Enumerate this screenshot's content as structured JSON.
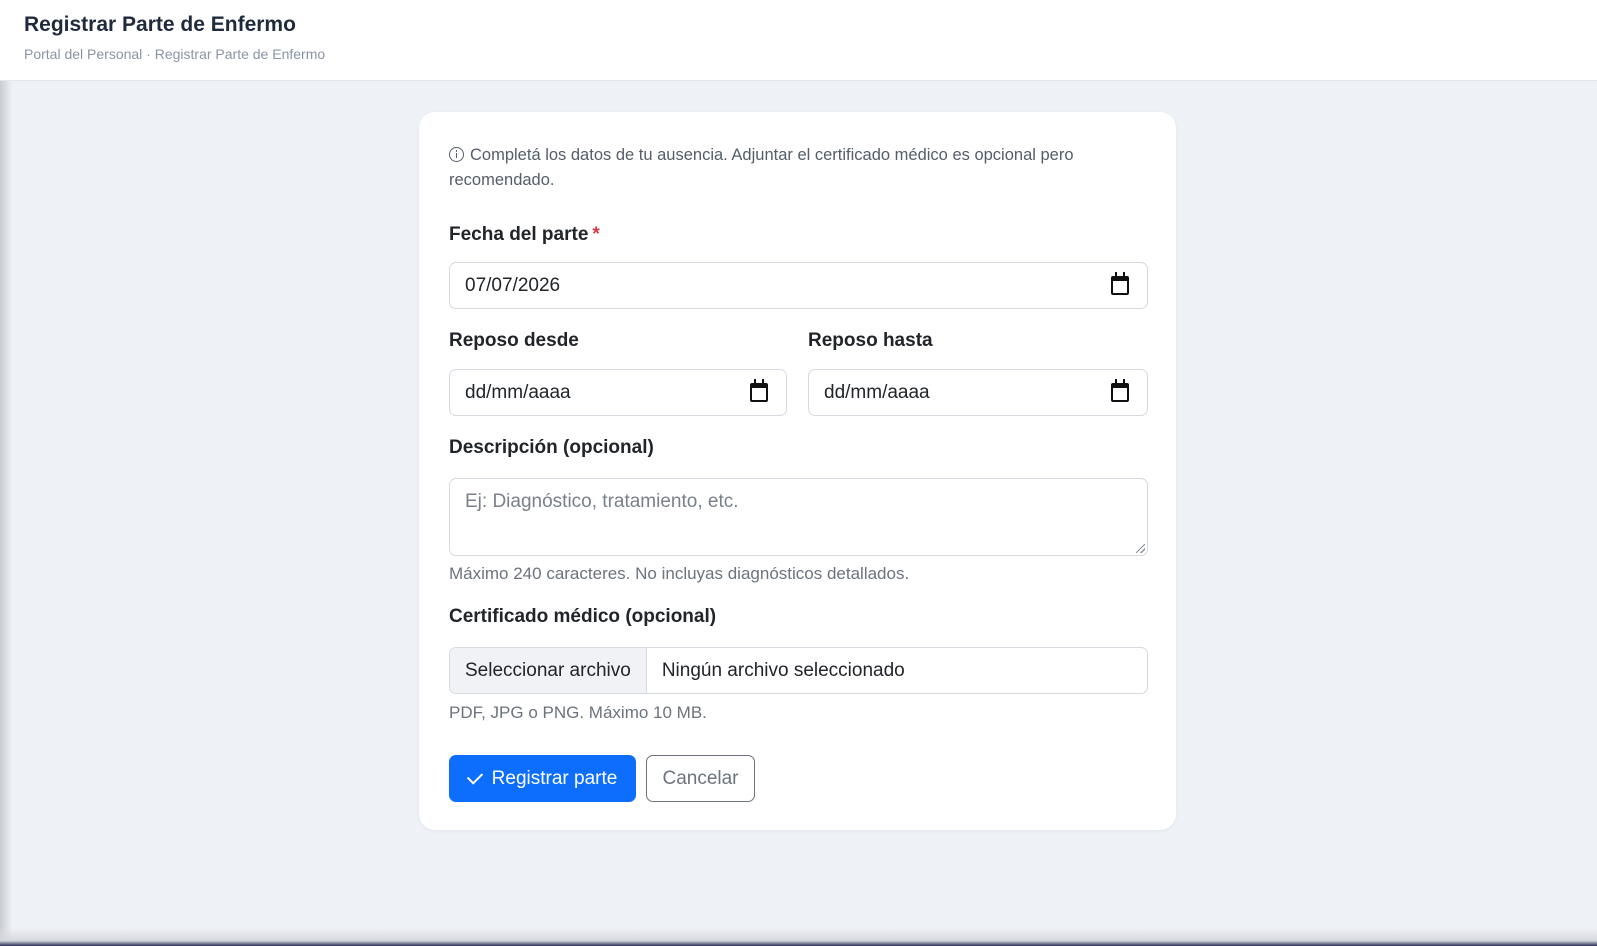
{
  "header": {
    "title": "Registrar Parte de Enfermo",
    "breadcrumb": "Portal del Personal · Registrar Parte de Enfermo"
  },
  "form": {
    "info_text": "Completá los datos de tu ausencia. Adjuntar el certificado médico es opcional pero recomendado.",
    "fecha_parte": {
      "label": "Fecha del parte",
      "required_mark": "*",
      "value": "07/07/2026"
    },
    "reposo_desde": {
      "label": "Reposo desde",
      "value": "dd/mm/aaaa"
    },
    "reposo_hasta": {
      "label": "Reposo hasta",
      "value": "dd/mm/aaaa"
    },
    "descripcion": {
      "label": "Descripción (opcional)",
      "placeholder": "Ej: Diagnóstico, tratamiento, etc.",
      "help": "Máximo 240 caracteres. No incluyas diagnósticos detallados."
    },
    "certificado": {
      "label": "Certificado médico (opcional)",
      "button": "Seleccionar archivo",
      "file_status": "Ningún archivo seleccionado",
      "help": "PDF, JPG o PNG. Máximo 10 MB."
    },
    "actions": {
      "submit": "Registrar parte",
      "cancel": "Cancelar"
    }
  },
  "icons": {
    "info": "info-circle-icon",
    "calendar": "calendar-icon",
    "check": "check-icon"
  },
  "colors": {
    "primary": "#0d6efd",
    "required": "#dc3545",
    "background": "#eef1f6"
  }
}
